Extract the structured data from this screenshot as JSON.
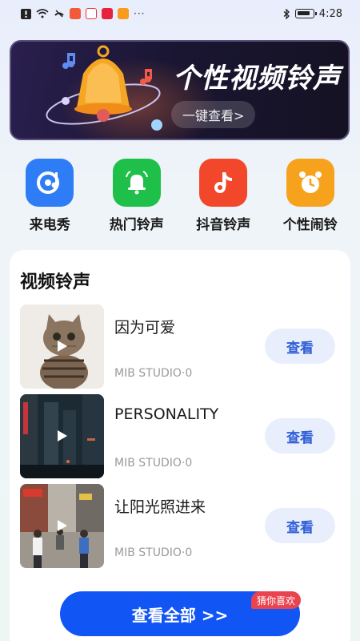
{
  "status_bar": {
    "time": "4:28",
    "dots": "···"
  },
  "banner": {
    "title": "个性视频铃声",
    "button_label": "一键查看>"
  },
  "quick_entries": [
    {
      "label": "来电秀",
      "icon": "caller-show-icon",
      "color": "#2f7df6"
    },
    {
      "label": "热门铃声",
      "icon": "bell-icon",
      "color": "#1fc04a"
    },
    {
      "label": "抖音铃声",
      "icon": "music-note-icon",
      "color": "#f2472b"
    },
    {
      "label": "个性闹铃",
      "icon": "alarm-clock-icon",
      "color": "#f7a21c"
    }
  ],
  "video_ringtones": {
    "section_title": "视频铃声",
    "items": [
      {
        "title": "因为可爱",
        "subtitle": "MIB STUDIO·0",
        "button": "查看"
      },
      {
        "title": "PERSONALITY",
        "subtitle": "MIB STUDIO·0",
        "button": "查看"
      },
      {
        "title": "让阳光照进来",
        "subtitle": "MIB STUDIO·0",
        "button": "查看"
      }
    ]
  },
  "footer": {
    "view_all_label": "查看全部 >>",
    "tag_label": "猜你喜欢"
  },
  "colors": {
    "accent": "#1255f5",
    "tag": "#e9434f"
  }
}
